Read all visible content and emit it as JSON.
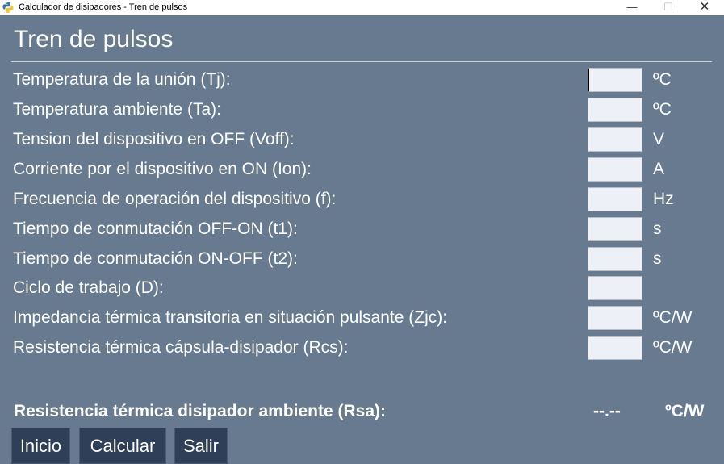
{
  "window": {
    "title": "Calculador de disipadores - Tren de pulsos",
    "icon": "python-icon",
    "controls": {
      "minimize": "—",
      "maximize": "☐",
      "close": "✕"
    }
  },
  "page": {
    "title": "Tren de pulsos"
  },
  "fields": [
    {
      "label": "Temperatura de la unión (Tj):",
      "value": "",
      "unit": "ºC"
    },
    {
      "label": "Temperatura ambiente (Ta):",
      "value": "",
      "unit": "ºC"
    },
    {
      "label": "Tension del dispositivo en OFF (Voff):",
      "value": "",
      "unit": "V"
    },
    {
      "label": "Corriente por el dispositivo en ON (Ion):",
      "value": "",
      "unit": "A"
    },
    {
      "label": "Frecuencia de operación del dispositivo (f):",
      "value": "",
      "unit": "Hz"
    },
    {
      "label": "Tiempo de conmutación OFF-ON (t1):",
      "value": "",
      "unit": "s"
    },
    {
      "label": "Tiempo de conmutación ON-OFF (t2):",
      "value": "",
      "unit": "s"
    },
    {
      "label": "Ciclo de trabajo (D):",
      "value": "",
      "unit": ""
    },
    {
      "label": "Impedancia térmica transitoria en situación pulsante (Zjc):",
      "value": "",
      "unit": "ºC/W"
    },
    {
      "label": "Resistencia térmica cápsula-disipador (Rcs):",
      "value": "",
      "unit": "ºC/W"
    }
  ],
  "result": {
    "label": "Resistencia térmica disipador ambiente (Rsa):",
    "value": "--.--",
    "unit": "ºC/W"
  },
  "buttons": {
    "inicio": "Inicio",
    "calcular": "Calcular",
    "salir": "Salir"
  },
  "colors": {
    "background": "#677a8f",
    "button_bg": "#2f3f57",
    "input_bg": "#eef0f7",
    "text": "#ffffff"
  }
}
